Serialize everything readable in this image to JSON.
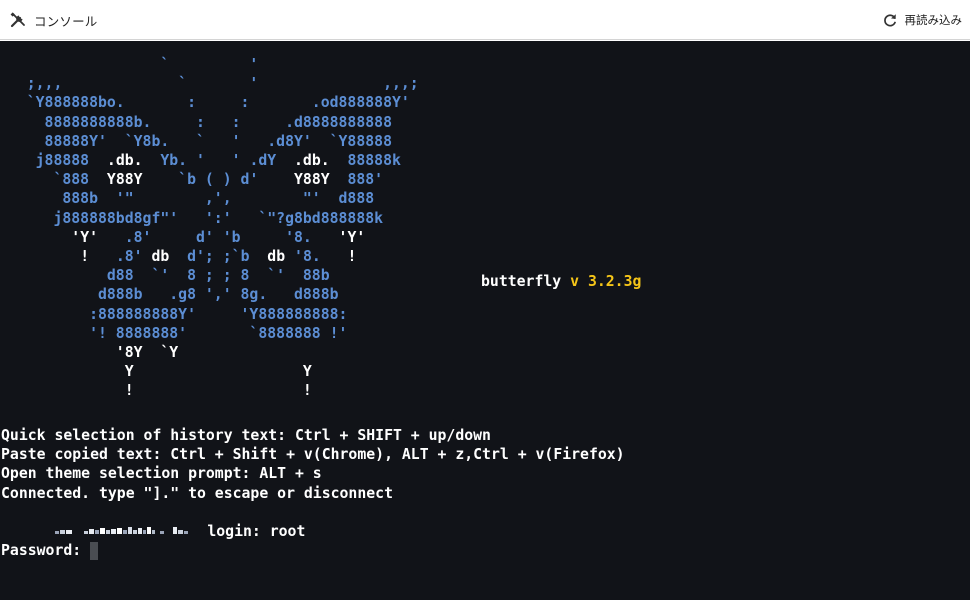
{
  "toolbar": {
    "title": "コンソール",
    "title_icon": "tools-icon",
    "reload_label": "再読み込み",
    "reload_icon": "reload-icon"
  },
  "terminal": {
    "ascii_art": [
      "                  `         '",
      "   ;,,,             `       '              ,,,;",
      "   `Y888888bo.       :     :       .od888888Y'",
      "     8888888888b.     :   :     .d8888888888",
      "     88888Y'  `Y8b.   `   '   .d8Y'  `Y88888",
      "    j88888  .db.  Yb. '   ' .dY  .db.  88888k",
      "      `888  Y88Y    `b ( ) d'    Y88Y  888'",
      "       888b  '\"        ,',        \"'  d888",
      "      j888888bd8gf\"'   ':'   `\"?g8bd888888k",
      "        'Y'   .8'     d' 'b     '8.   'Y'",
      "         !   .8' db  d'; ;`b  db '8.   !",
      "            d88  `'  8 ; ; 8  `'  88b",
      "           d888b   .g8 ',' 8g.   d888b",
      "          :888888888Y'     'Y888888888:",
      "          '! 8888888'       `8888888 !'",
      "             '8Y  `Y",
      "              Y                   Y",
      "              !                   !"
    ],
    "banner": {
      "name": "butterfly",
      "version_prefix": "v",
      "version": "3.2.3g"
    },
    "help_lines": [
      "Quick selection of history text: Ctrl + SHIFT + up/down",
      "Paste copied text: Ctrl + Shift + v(Chrome), ALT + z,Ctrl + v(Firefox)",
      "Open theme selection prompt: ALT + s",
      "Connected. type \"].\" to escape or disconnect"
    ],
    "login_prompt": " login: root",
    "password_prompt": "Password:"
  },
  "colors": {
    "art_blue": "#5c8ed4",
    "version_yellow": "#f5c518",
    "terminal_bg": "#111318"
  }
}
